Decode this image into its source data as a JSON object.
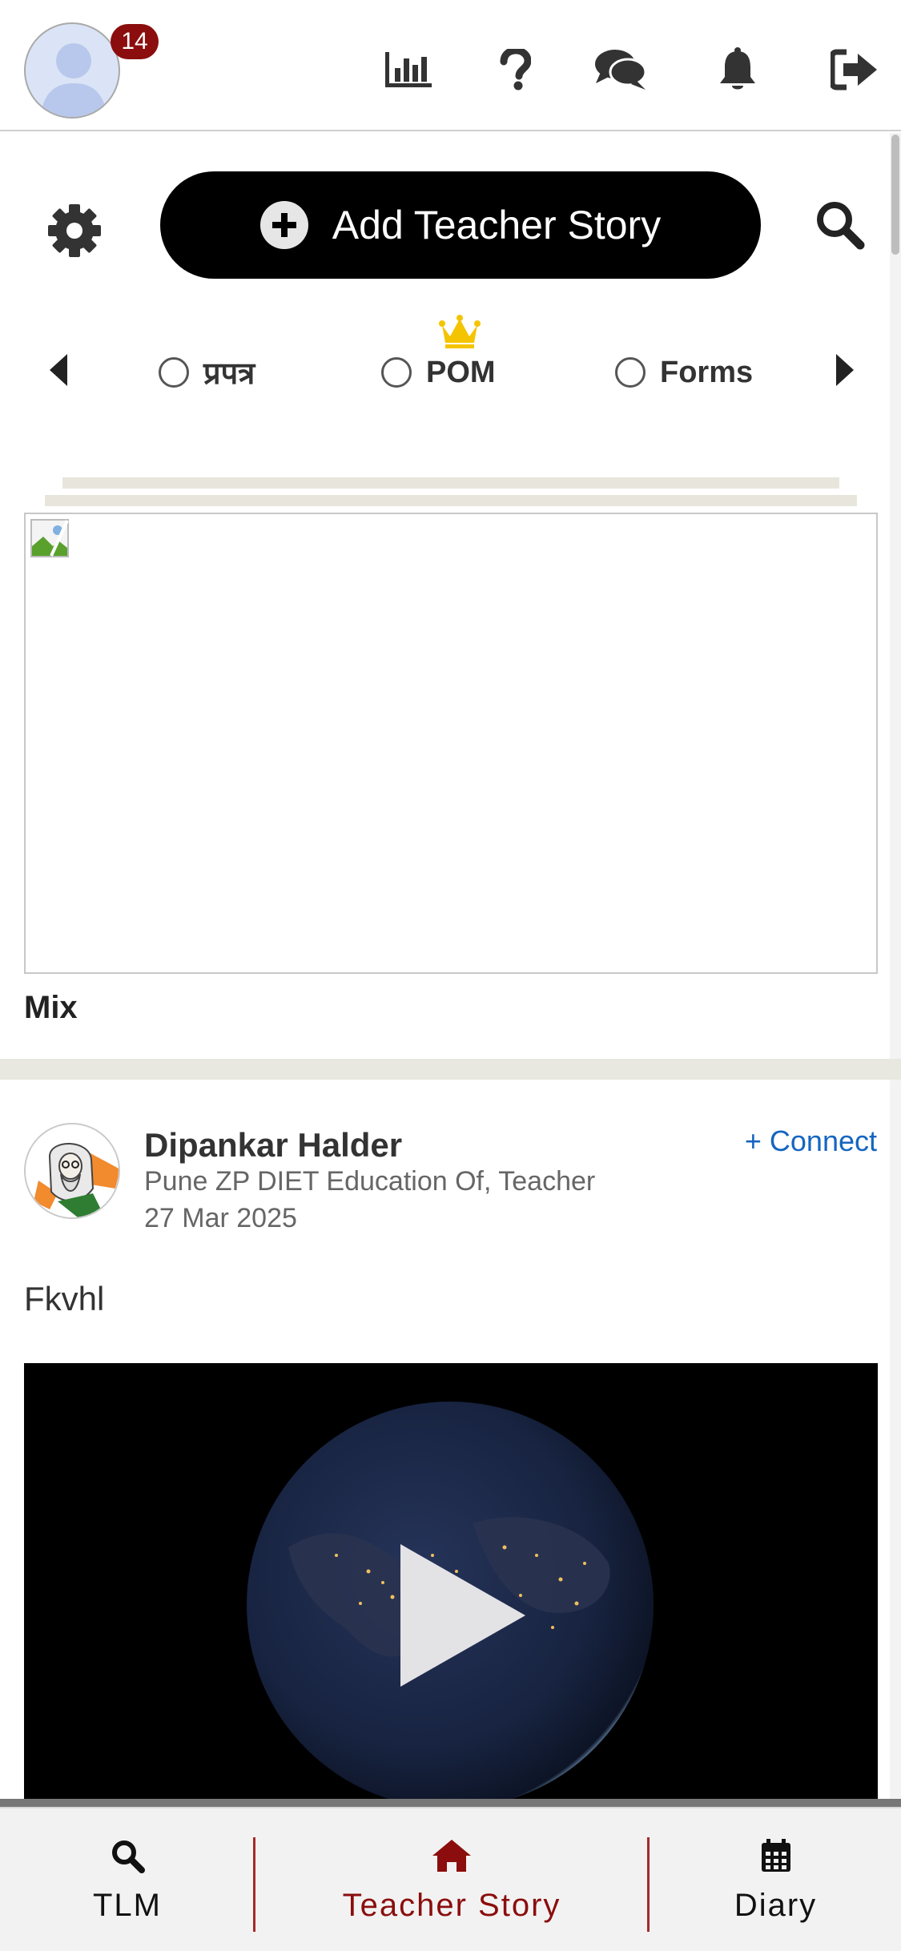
{
  "header": {
    "notification_count": "14",
    "icons": [
      "chart-icon",
      "help-icon",
      "chat-icon",
      "bell-icon",
      "logout-icon"
    ]
  },
  "actions": {
    "add_story_label": "Add Teacher Story"
  },
  "filters": {
    "items": [
      {
        "label": "प्रपत्र",
        "selected": false
      },
      {
        "label": "POM",
        "selected": false,
        "premium": true
      },
      {
        "label": "Forms",
        "selected": false
      }
    ]
  },
  "featured": {
    "label": "Mix"
  },
  "post": {
    "author": "Dipankar Halder",
    "subtitle": "Pune ZP DIET Education Of, Teacher",
    "date": "27 Mar 2025",
    "connect_label": "+ Connect",
    "text": "Fkvhl"
  },
  "bottom_nav": {
    "items": [
      {
        "label": "TLM",
        "icon": "search-icon",
        "active": false
      },
      {
        "label": "Teacher Story",
        "icon": "home-icon",
        "active": true
      },
      {
        "label": "Diary",
        "icon": "calendar-icon",
        "active": false
      }
    ]
  },
  "colors": {
    "accent": "#8b0d0d",
    "link": "#1565c0",
    "primary_button": "#000000"
  }
}
